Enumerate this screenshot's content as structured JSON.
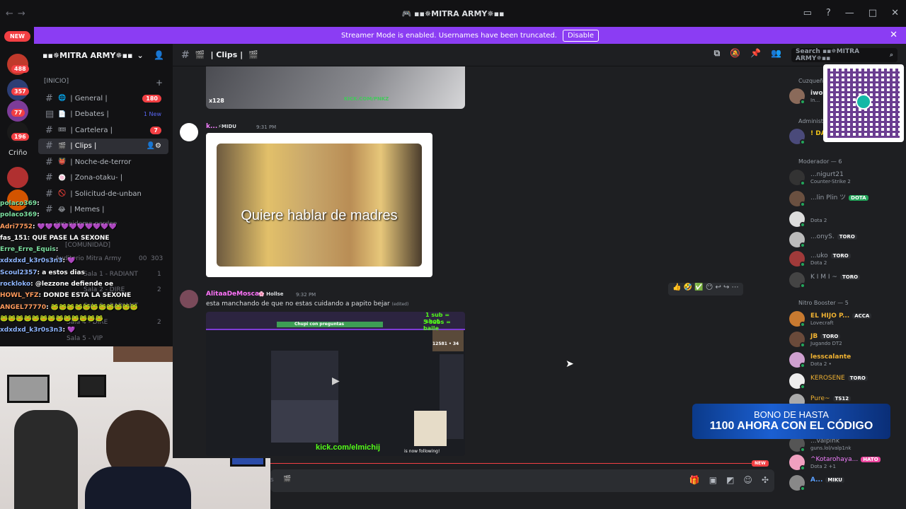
{
  "window": {
    "title": "🎮 ▪▪✵MITRA ARMY✵▪▪"
  },
  "banner": {
    "text": "Streamer Mode is enabled. Usernames have been truncated.",
    "button": "Disable"
  },
  "guilds": {
    "new_label": "NEW",
    "badges": [
      "488",
      "357",
      "77",
      "196"
    ],
    "label": "Criño"
  },
  "server": {
    "name": "▪▪✵MITRA ARMY✵▪▪"
  },
  "channels": {
    "category_inicio": "[INICIO]",
    "category_comunidad": "[COMUNIDAD]",
    "items": [
      {
        "name": "| General |",
        "emoji": "🌐",
        "count": "180"
      },
      {
        "name": "| Debates |",
        "emoji": "📄",
        "new": "1 New"
      },
      {
        "name": "| Cartelera |",
        "emoji": "🎟",
        "count": "7"
      },
      {
        "name": "| Clips |",
        "emoji": "🎬"
      },
      {
        "name": "| Noche-de-terror",
        "emoji": "👹"
      },
      {
        "name": "| Zona-otaku- |",
        "emoji": "🍥"
      },
      {
        "name": "| Solicitud-de-unban",
        "emoji": "🚫"
      },
      {
        "name": "| Memes |",
        "emoji": "😂"
      }
    ],
    "ghost": [
      "iwo-pideme-perdon",
      "Auditorio Mitra Army",
      "Sala 1 - RADIANT",
      "Sala 2 - DIRE",
      "Sala 3 - RADIANT",
      "Sala 4 - DIRE",
      "Sala 5 - VIP"
    ],
    "ghost_counts": [
      "00",
      "303",
      "1",
      "2",
      "2"
    ]
  },
  "stream_chat": [
    {
      "user": "polaco369",
      "msg": ":"
    },
    {
      "user": "polaco369",
      "msg": ":"
    },
    {
      "user": "Adri7752",
      "msg": ": 💜💜💜💜💜💜💜💜💜💜"
    },
    {
      "user": "fas_151",
      "msg": ": QUE PASE LA SEXONE"
    },
    {
      "user": "Erre_Erre_Equis",
      "msg": ":"
    },
    {
      "user": "xdxdxd_k3r0s3n3",
      "msg": ": 💜"
    },
    {
      "user": "Scoul2357",
      "msg": ": a estos dias"
    },
    {
      "user": "rockloko",
      "msg": ": @lezzone defiende oe"
    },
    {
      "user": "HOWL_YFZ",
      "msg": ": DONDE ESTA LA SEXONE"
    },
    {
      "user": "ANGEL77770",
      "msg": ": 🐸🐸🐸🐸🐸🐸🐸🐸🐸🐸🐸"
    },
    {
      "user": "",
      "msg": "🐸🐸🐸🐸🐸🐸🐸🐸🐸🐸🐸🐸🐸"
    },
    {
      "user": "xdxdxd_k3r0s3n3",
      "msg": ": 💜"
    }
  ],
  "header": {
    "channel": "| Clips |",
    "search_placeholder": "Search ▪▪✵MITRA ARMY✵▪▪"
  },
  "messages": {
    "img_top": {
      "watermark": "KICK.COM/PNKZ",
      "count": "x128"
    },
    "m1": {
      "user": "k...",
      "badge": "⚡MIDU",
      "time": "9:31 PM",
      "caption": "Quiere hablar de madres"
    },
    "m2": {
      "user": "AlitaaDeMosca",
      "badge": "🌸 Hollse",
      "time": "9:32 PM",
      "text": "esta manchando de que no estas cuidando a papito bejar",
      "edited": "(edited)"
    },
    "reactions": "👍 🤣 ✅ 😶 ↩ ↪ ⋯",
    "video": {
      "label1": "1 sub = shot",
      "label2": "5 subs = baile",
      "ask": "Chupi con preguntas",
      "kick": "kick.com/elmichij",
      "follow": "is now following!",
      "stat": "12581 • 34"
    }
  },
  "composer": {
    "new_label": "NEW",
    "placeholder": "s"
  },
  "members": {
    "cat_cuzquen": "Cuzqueñ...",
    "cat_admin": "Administ...",
    "cat_mod": "Moderador — 6",
    "cat_nitro": "Nitro Booster — 5",
    "list": [
      {
        "name": "iwo",
        "status": "In...",
        "color": "#ffffff",
        "tag": ""
      },
      {
        "name": "! DA",
        "status": "",
        "color": "#f0c419",
        "tag": ""
      },
      {
        "name": "...nigurt21",
        "status": "Counter-Strike 2",
        "color": "#949ba4",
        "tag": ""
      },
      {
        "name": "...lin Plin ツ",
        "status": "",
        "color": "#949ba4",
        "tag": "DOTA"
      },
      {
        "name": "",
        "status": "Dota 2",
        "color": "#949ba4",
        "tag": ""
      },
      {
        "name": "...onyS.",
        "status": "",
        "color": "#949ba4",
        "tag": "TORO"
      },
      {
        "name": "...uko",
        "status": "Dota 2",
        "color": "#949ba4",
        "tag": "TORO"
      },
      {
        "name": "K I M I ~",
        "status": "",
        "color": "#949ba4",
        "tag": "TORO"
      },
      {
        "name": "EL HIJO P...",
        "status": "Lovecraft",
        "color": "#f0b232",
        "tag": "ACCA"
      },
      {
        "name": "JB",
        "status": "Jugando DT2",
        "color": "#f0b232",
        "tag": "TORO"
      },
      {
        "name": "lesscalante",
        "status": "Dota 2 • ",
        "color": "#f0b232",
        "tag": ""
      },
      {
        "name": "KEROSENE",
        "status": "",
        "color": "#f0b232",
        "tag": "TORO"
      },
      {
        "name": "Pure~",
        "status": "",
        "color": "#f0b232",
        "tag": "TS12"
      },
      {
        "name": "...valpink",
        "status": "guns.lol/valp1nk",
        "color": "#949ba4",
        "tag": ""
      },
      {
        "name": "^Kotarohaya...",
        "status": "Dota 2 +1",
        "color": "#f47fff",
        "tag": "HATO"
      },
      {
        "name": "A...",
        "status": "",
        "color": "#5aa0ff",
        "tag": "MIKU"
      }
    ]
  },
  "promo": {
    "line1": "BONO DE HASTA",
    "line2": "1100 AHORA CON EL CÓDIGO"
  }
}
